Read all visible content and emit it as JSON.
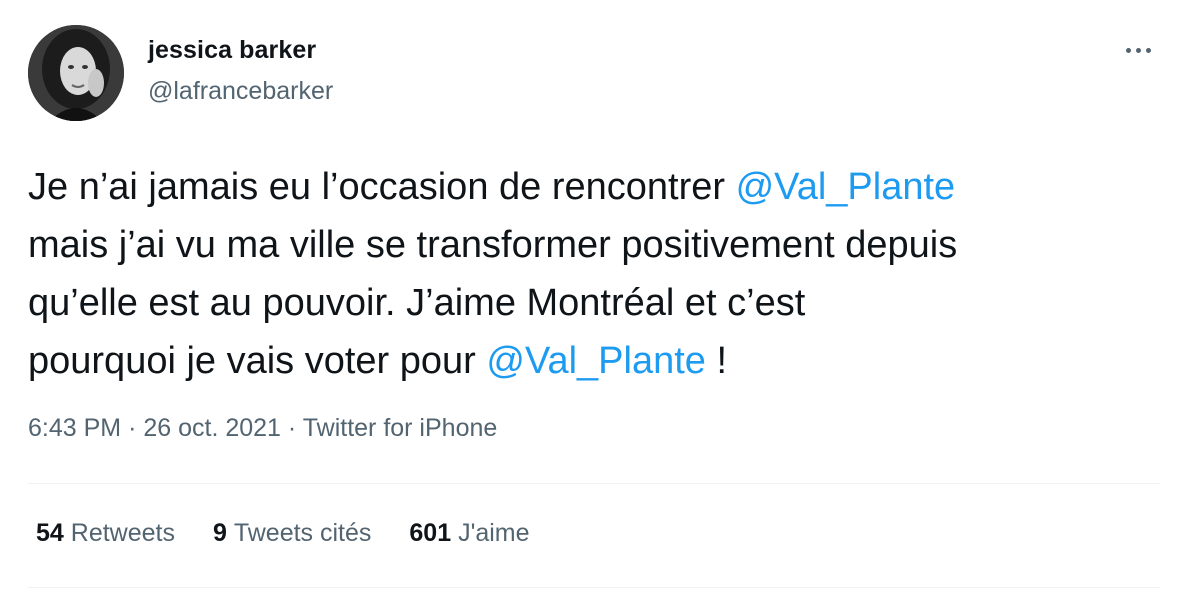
{
  "author": {
    "name": "jessica barker",
    "handle": "@lafrancebarker"
  },
  "tweet": {
    "lines": [
      [
        {
          "text": "Je n’ai jamais eu l’occasion de rencontrer "
        },
        {
          "text": "@Val_Plante",
          "mention": true
        }
      ],
      [
        {
          "text": "mais j’ai vu ma ville se transformer positivement depuis"
        }
      ],
      [
        {
          "text": "qu’elle est au pouvoir. J’aime Montréal et c’est"
        }
      ],
      [
        {
          "text": "pourquoi je vais voter pour "
        },
        {
          "text": "@Val_Plante",
          "mention": true
        },
        {
          "text": " !"
        }
      ]
    ]
  },
  "meta": {
    "time": "6:43 PM",
    "date": "26 oct. 2021",
    "source": "Twitter for iPhone",
    "separator": "·"
  },
  "stats": {
    "retweets_count": "54",
    "retweets_label": "Retweets",
    "quotes_count": "9",
    "quotes_label": "Tweets cités",
    "likes_count": "601",
    "likes_label": "J'aime"
  },
  "colors": {
    "mention": "#1d9bf0",
    "secondary_text": "#536471",
    "primary_text": "#0f1419",
    "divider": "#eff3f4"
  },
  "icons": {
    "more": "more-dots-icon"
  }
}
